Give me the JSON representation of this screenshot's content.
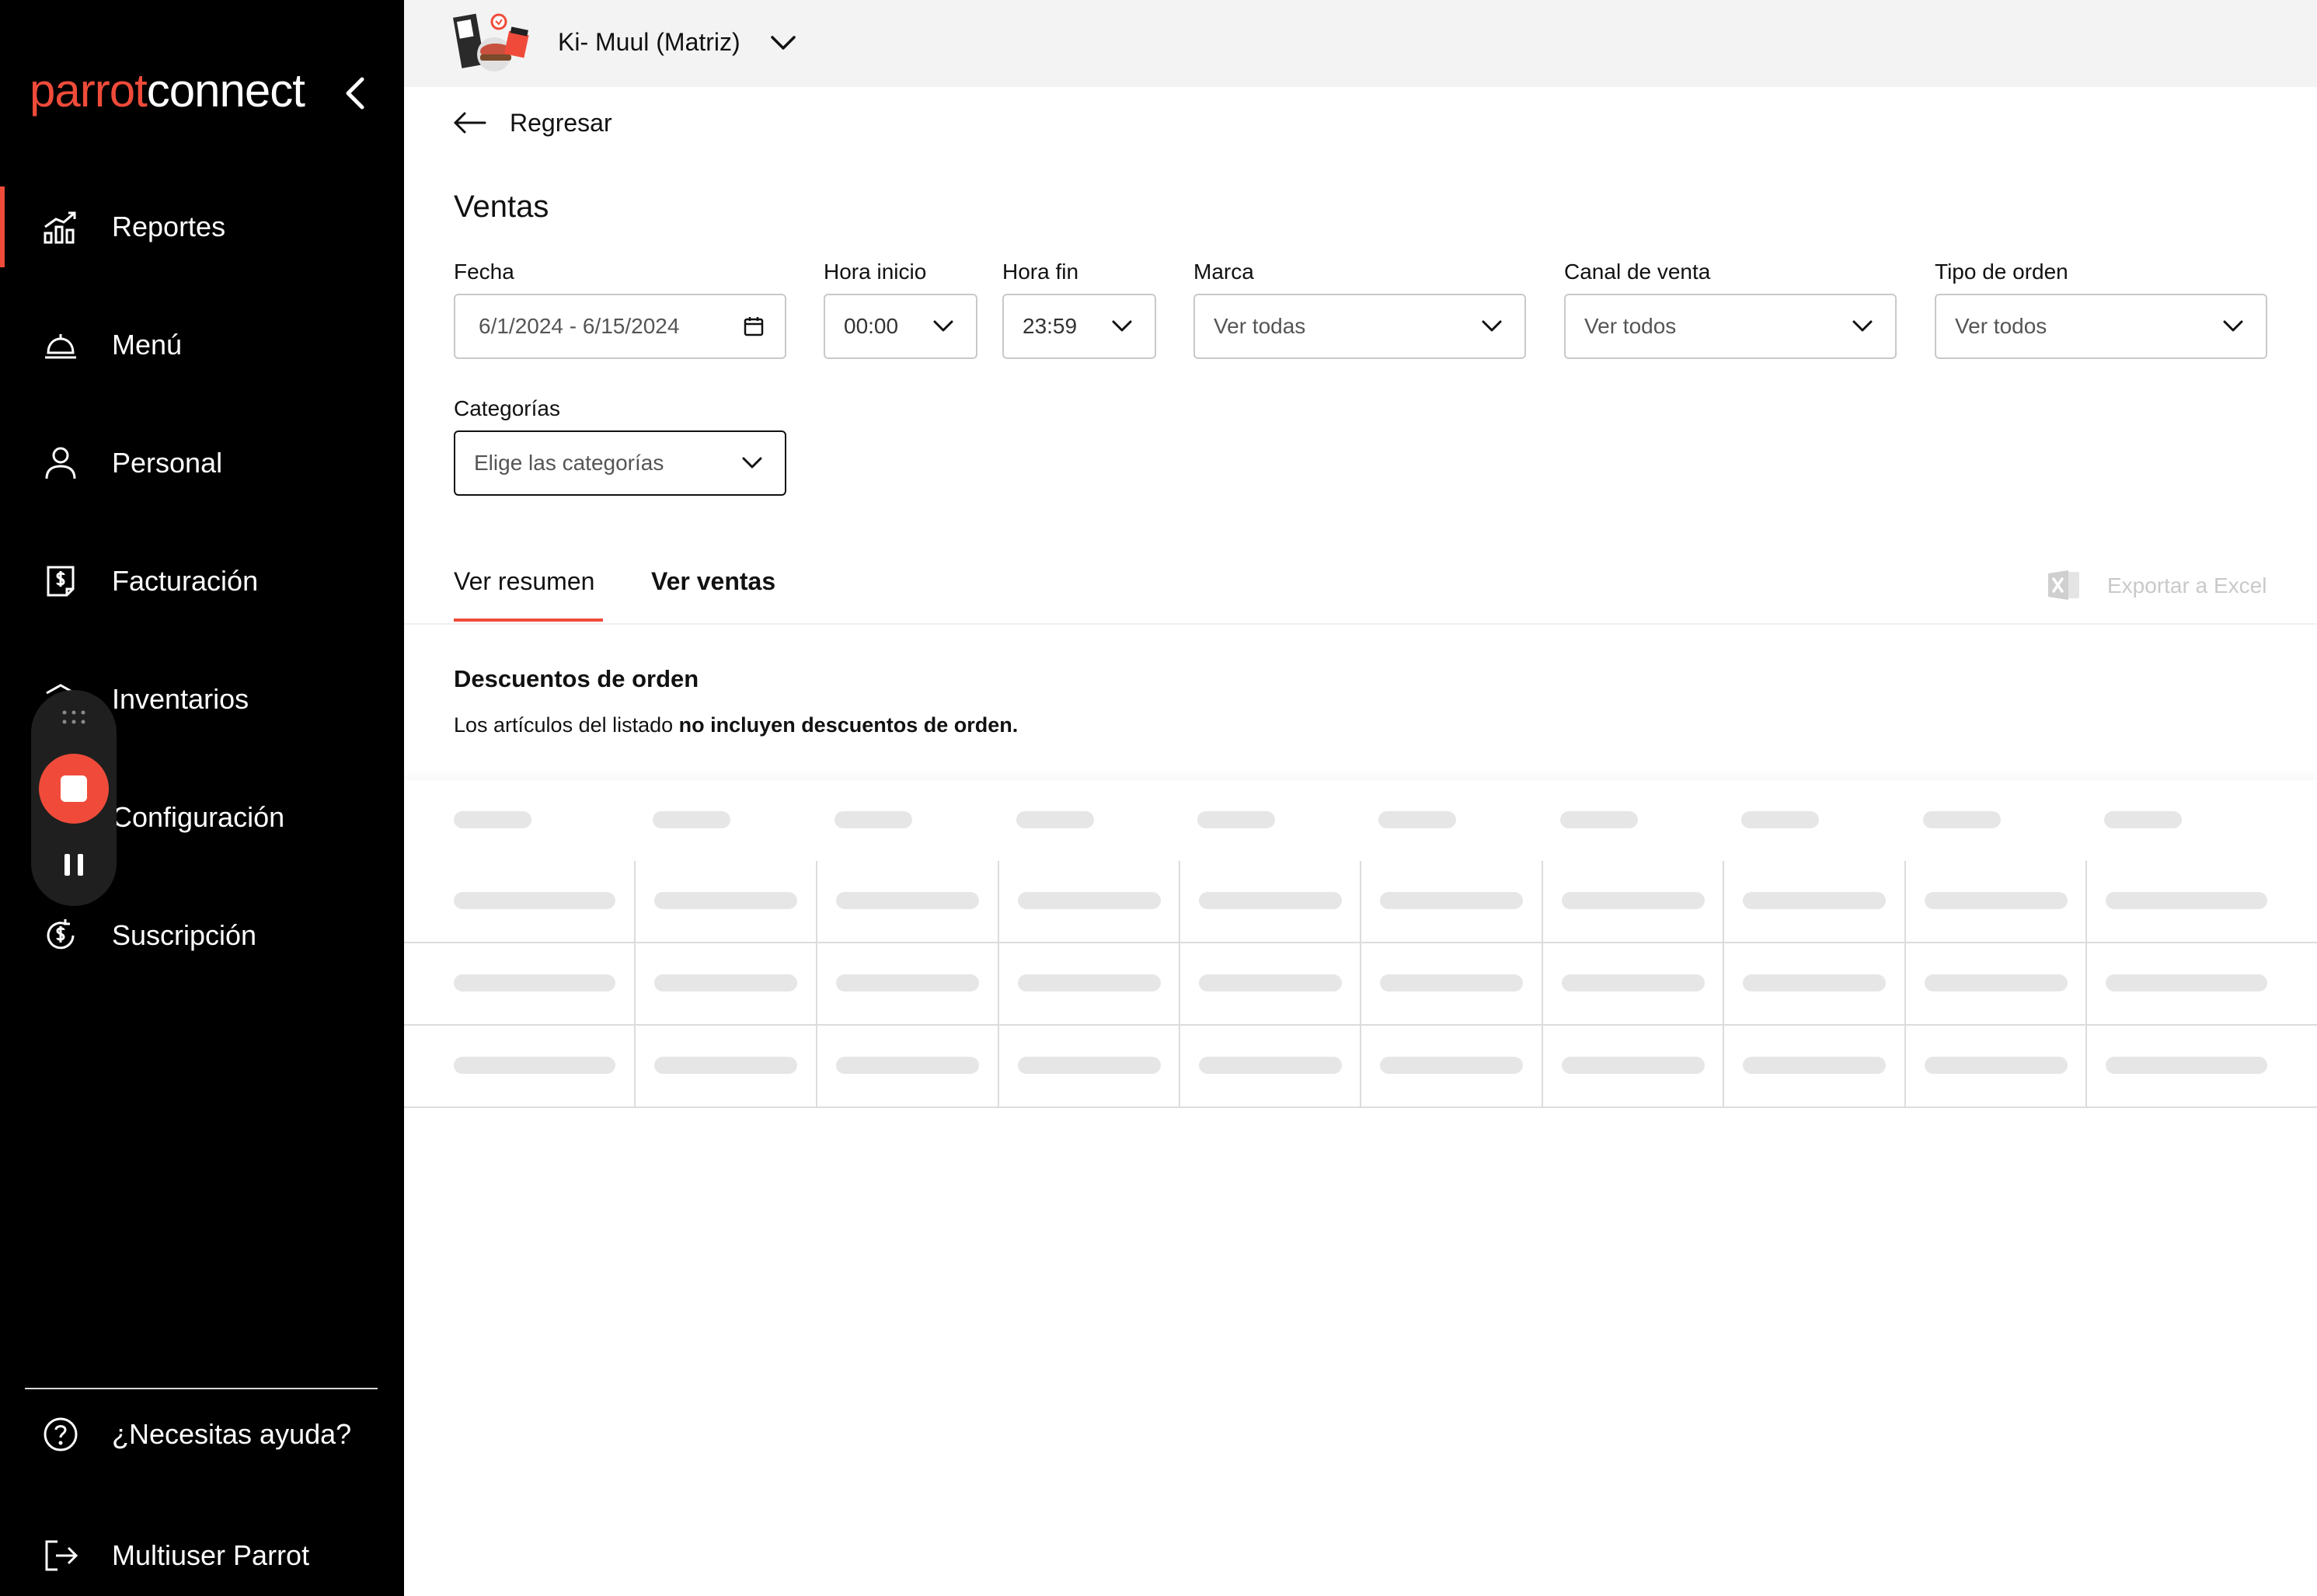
{
  "sidebar": {
    "logo": {
      "part1": "parrot",
      "part2": "connect"
    },
    "items": [
      {
        "label": "Reportes",
        "icon": "chart-icon",
        "active": true
      },
      {
        "label": "Menú",
        "icon": "bell-icon"
      },
      {
        "label": "Personal",
        "icon": "person-icon"
      },
      {
        "label": "Facturación",
        "icon": "invoice-icon"
      },
      {
        "label": "Inventarios",
        "icon": "inventory-icon"
      },
      {
        "label": "Configuración",
        "icon": "gear-icon"
      },
      {
        "label": "Suscripción",
        "icon": "subscription-icon"
      }
    ],
    "help_label": "¿Necesitas ayuda?",
    "user_label": "Multiuser Parrot"
  },
  "topbar": {
    "store_name": "Ki- Muul (Matriz)"
  },
  "page": {
    "back_label": "Regresar",
    "title": "Ventas"
  },
  "filters": {
    "fecha": {
      "label": "Fecha",
      "value": "6/1/2024 - 6/15/2024"
    },
    "hora_inicio": {
      "label": "Hora inicio",
      "value": "00:00"
    },
    "hora_fin": {
      "label": "Hora fin",
      "value": "23:59"
    },
    "marca": {
      "label": "Marca",
      "value": "Ver todas"
    },
    "canal": {
      "label": "Canal de venta",
      "value": "Ver todos"
    },
    "tipo": {
      "label": "Tipo de orden",
      "value": "Ver todos"
    },
    "categorias": {
      "label": "Categorías",
      "value": "Elige las categorías"
    }
  },
  "tabs": [
    {
      "label": "Ver resumen",
      "active": true
    },
    {
      "label": "Ver ventas",
      "active": false
    }
  ],
  "export_label": "Exportar a Excel",
  "notice": {
    "title": "Descuentos de orden",
    "text_prefix": "Los artículos del listado ",
    "text_bold": "no incluyen descuentos de orden."
  },
  "colors": {
    "accent": "#f04b3a",
    "sidebar_bg": "#000000",
    "topbar_bg": "#f3f3f4"
  }
}
